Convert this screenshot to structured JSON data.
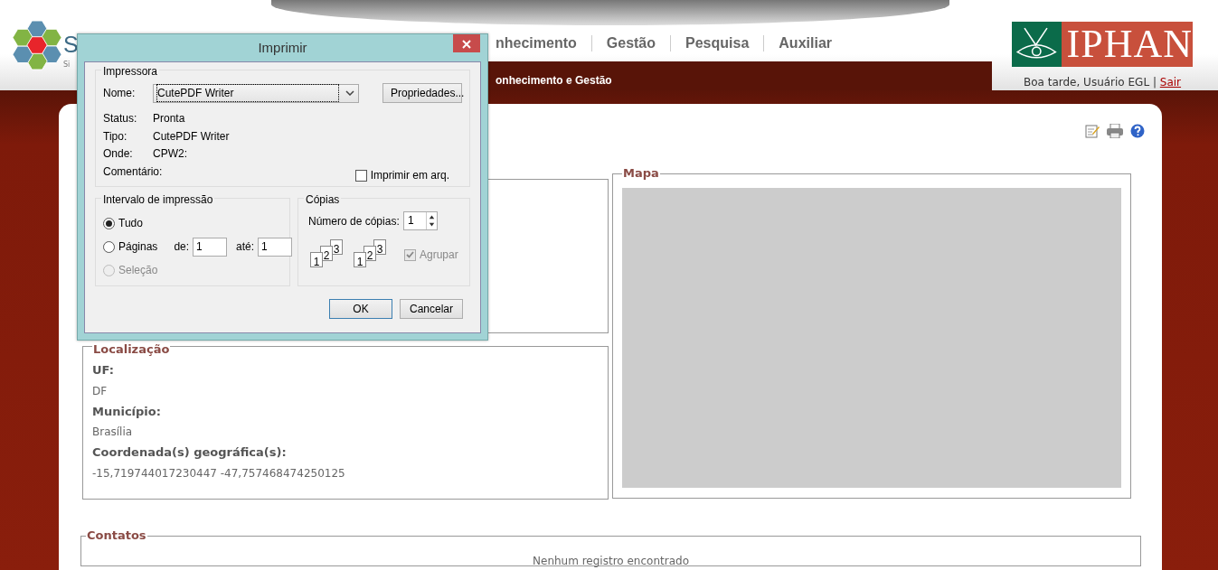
{
  "header": {
    "logo_text": "S",
    "logo_subtext": "Si",
    "nav": [
      {
        "label": "nhecimento"
      },
      {
        "label": "Gestão"
      },
      {
        "label": "Pesquisa"
      },
      {
        "label": "Auxiliar"
      }
    ],
    "subtitle": "onhecimento e Gestão",
    "brand": "IPHAN",
    "greeting": "Boa tarde, Usuário EGL",
    "separator": "|",
    "logout": "Sair"
  },
  "location": {
    "legend": "Localização",
    "fields": [
      {
        "label": "UF:",
        "value": "DF"
      },
      {
        "label": "Município:",
        "value": "Brasília"
      },
      {
        "label": "Coordenada(s) geográfica(s):",
        "value": "-15,719744017230447 -47,757468474250125"
      }
    ]
  },
  "map": {
    "legend": "Mapa"
  },
  "contacts": {
    "legend": "Contatos",
    "empty": "Nenhum registro encontrado"
  },
  "dialog": {
    "title": "Imprimir",
    "printer": {
      "legend": "Impressora",
      "name_label": "Nome:",
      "name_value": "CutePDF Writer",
      "properties": "Propriedades...",
      "info": [
        {
          "label": "Status:",
          "value": "Pronta"
        },
        {
          "label": "Tipo:",
          "value": "CutePDF Writer"
        },
        {
          "label": "Onde:",
          "value": "CPW2:"
        },
        {
          "label": "Comentário:"
        }
      ],
      "print_to_file": {
        "label": "Imprimir em arq.",
        "checked": false
      }
    },
    "range": {
      "legend": "Intervalo de impressão",
      "options": [
        {
          "label": "Tudo",
          "selected": true,
          "disabled": false
        },
        {
          "label": "Páginas",
          "selected": false,
          "disabled": false
        },
        {
          "label": "Seleção",
          "selected": false,
          "disabled": true
        }
      ],
      "from_label": "de:",
      "from": "1",
      "to_label": "até:",
      "to": "1"
    },
    "copies": {
      "legend": "Cópias",
      "count_label": "Número de cópias:",
      "count": "1",
      "collate_icons": [
        [
          "1",
          "2",
          "3"
        ],
        [
          "1",
          "2",
          "3"
        ]
      ],
      "collate": {
        "label": "Agrupar",
        "checked": true,
        "disabled": true
      }
    },
    "buttons": [
      "OK",
      "Cancelar"
    ]
  }
}
